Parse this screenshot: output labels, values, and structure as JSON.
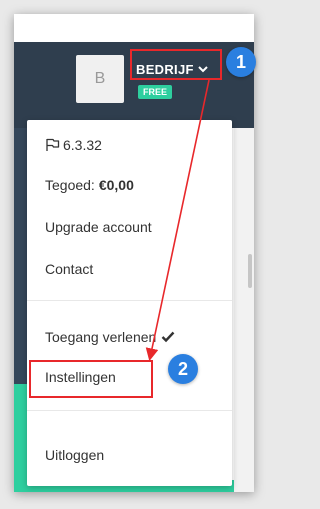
{
  "header": {
    "avatar_initial": "B",
    "company_name": "BEDRIJF",
    "plan_badge": "FREE"
  },
  "menu": {
    "version": "6.3.32",
    "credit_label": "Tegoed:",
    "credit_value": "€0,00",
    "upgrade": "Upgrade account",
    "contact": "Contact",
    "grant_access": "Toegang verlenen",
    "settings": "Instellingen",
    "logout": "Uitloggen"
  },
  "annotations": {
    "step1": "1",
    "step2": "2",
    "highlight_color": "#e8282b",
    "badge_color": "#2a7fe0"
  },
  "icons": {
    "version": "flag-icon",
    "company_dropdown": "chevron-down-icon",
    "grant_access_state": "checkmark-icon"
  },
  "colors": {
    "navbar": "#2f3e4e",
    "accent_green": "#2ecf9f"
  }
}
